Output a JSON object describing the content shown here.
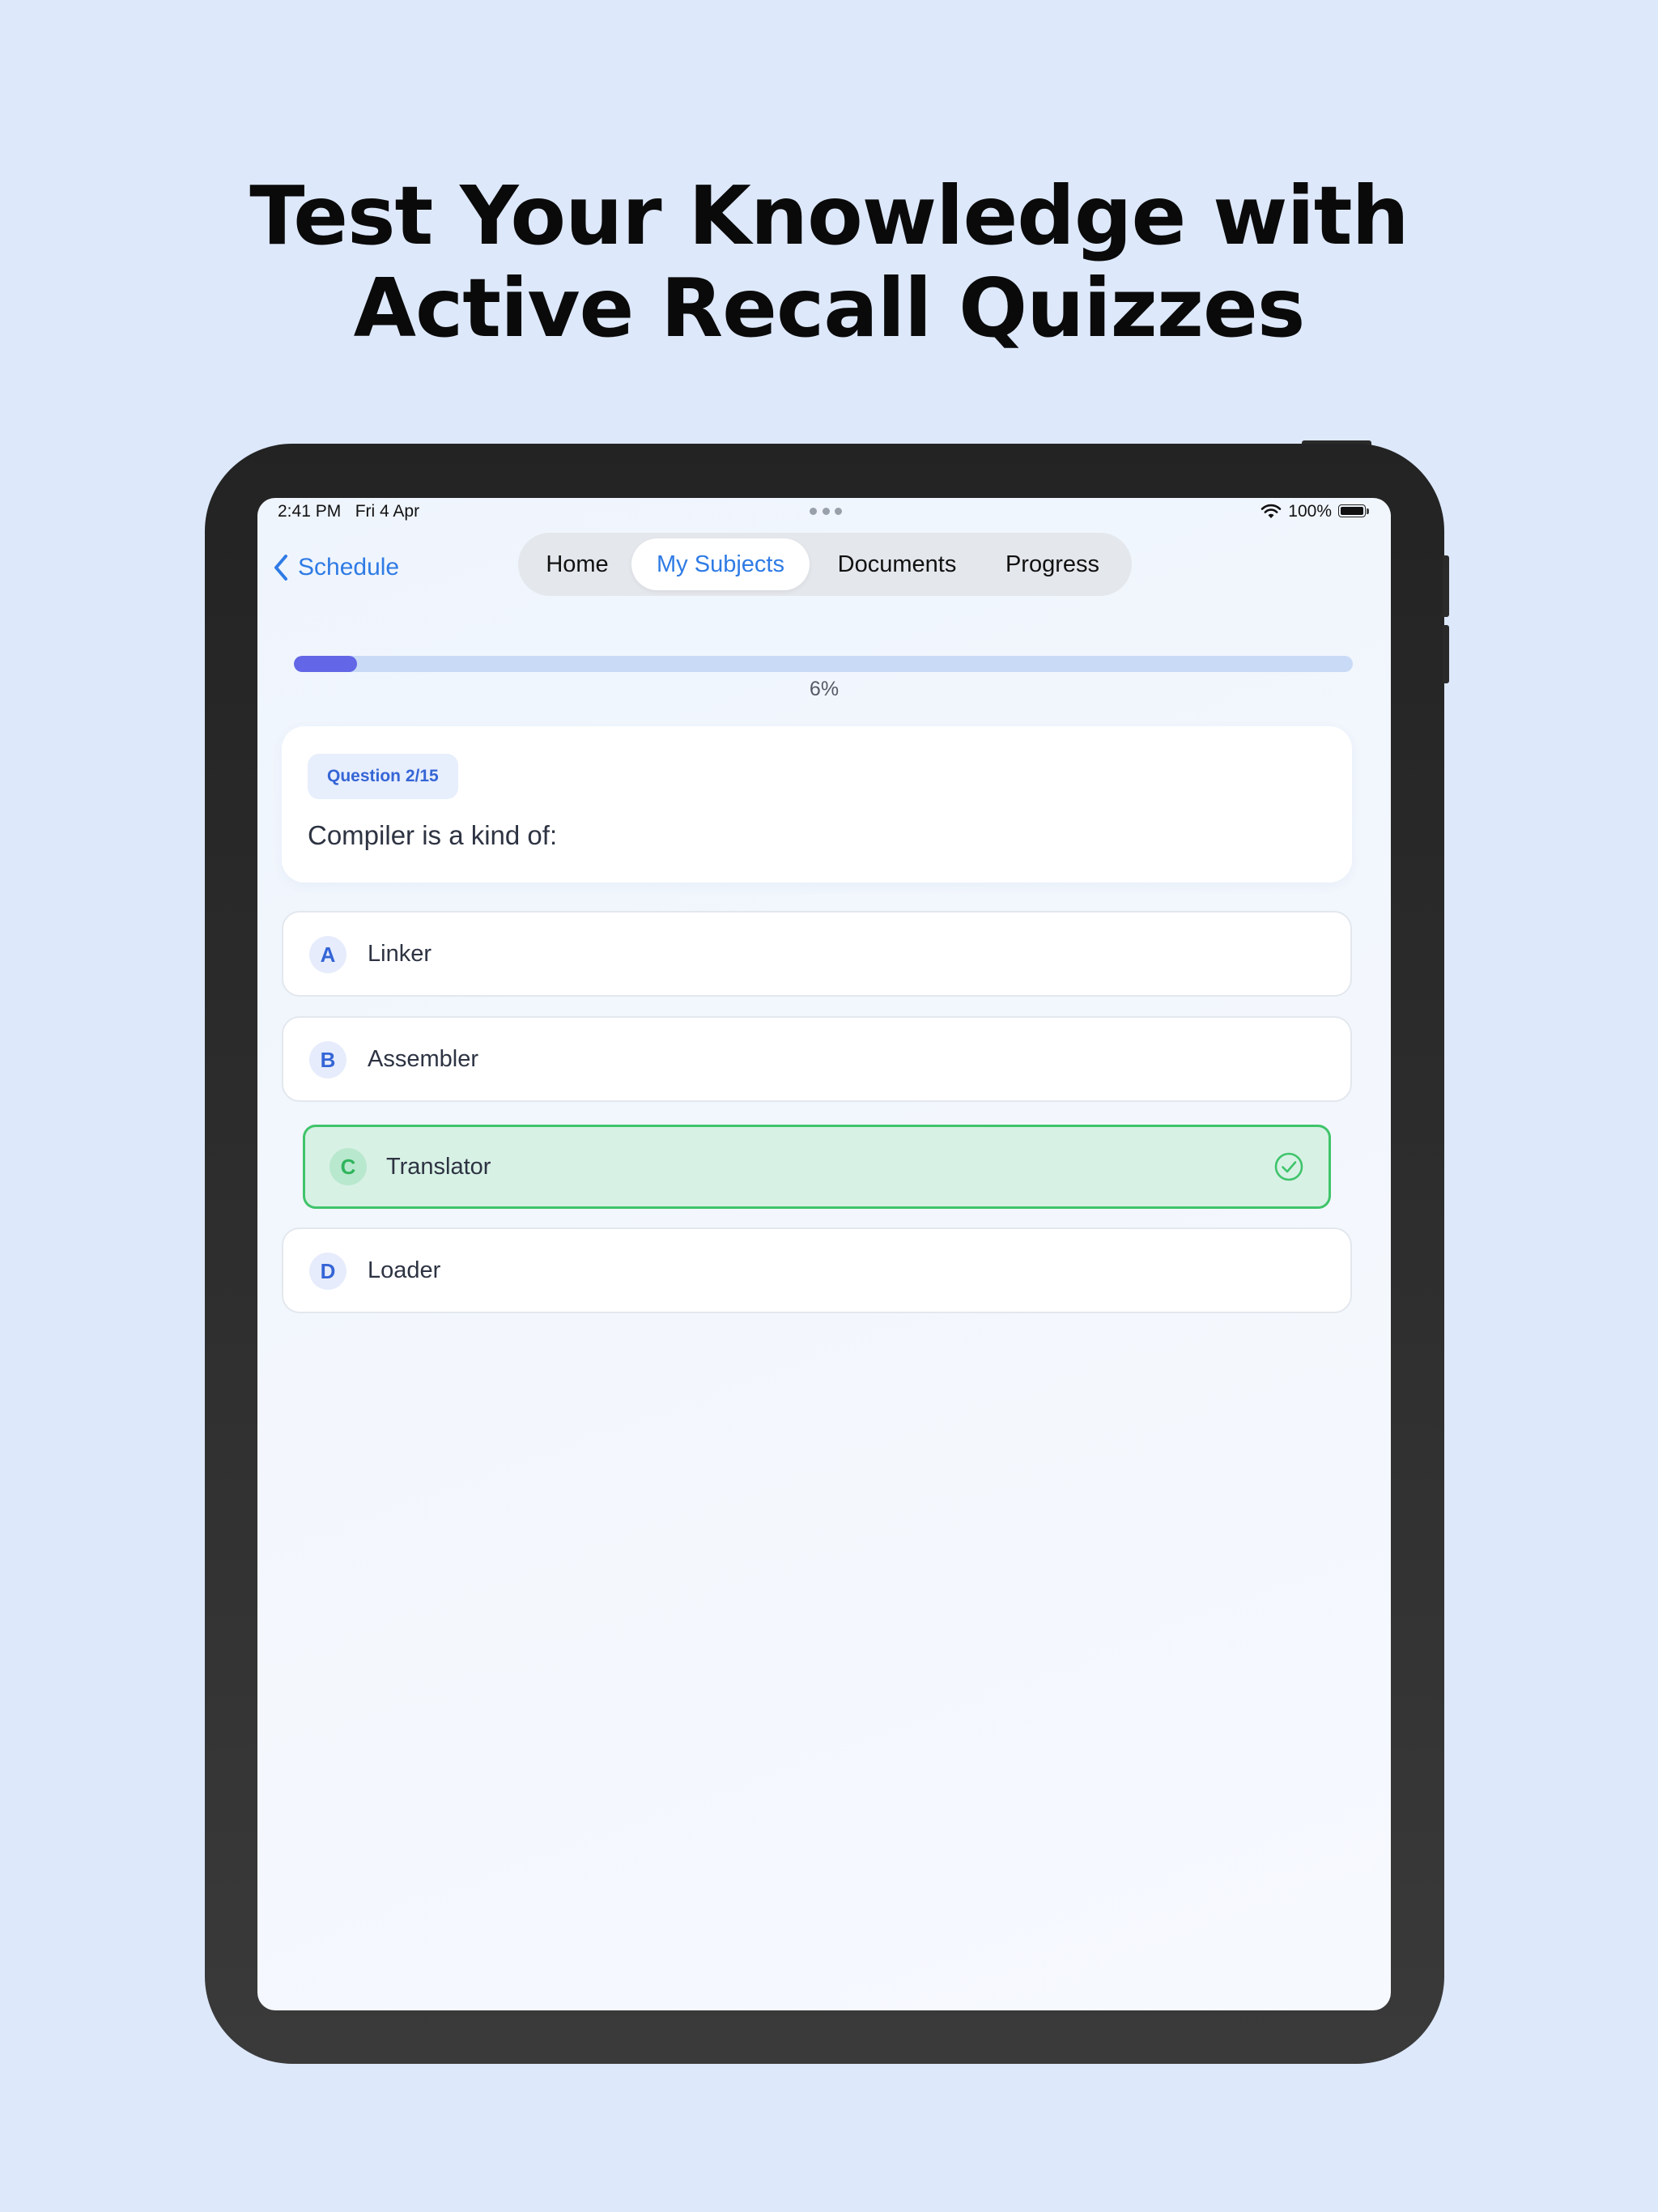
{
  "headline": {
    "line1": "Test Your Knowledge with",
    "line2": "Active Recall Quizzes"
  },
  "status_bar": {
    "time": "2:41 PM",
    "date": "Fri 4 Apr",
    "battery": "100%",
    "icons": [
      "wifi-icon",
      "battery-icon"
    ]
  },
  "nav": {
    "back_label": "Schedule",
    "back_icon": "chevron-left-icon",
    "tabs": [
      {
        "label": "Home",
        "active": false
      },
      {
        "label": "My Subjects",
        "active": true
      },
      {
        "label": "Documents",
        "active": false
      },
      {
        "label": "Progress",
        "active": false
      }
    ]
  },
  "progress": {
    "percent": 6,
    "label": "6%",
    "fill_color": "#6366e6",
    "track_color": "#c9daf6"
  },
  "question": {
    "badge": "Question 2/15",
    "text": "Compiler is a kind of:"
  },
  "options": [
    {
      "letter": "A",
      "label": "Linker",
      "selected": false
    },
    {
      "letter": "B",
      "label": "Assembler",
      "selected": false
    },
    {
      "letter": "C",
      "label": "Translator",
      "selected": true,
      "icon": "check-circle-icon"
    },
    {
      "letter": "D",
      "label": "Loader",
      "selected": false
    }
  ],
  "colors": {
    "background": "#dde8fb",
    "accent": "#2f7be5",
    "correct": "#3fc46a",
    "correct_bg": "#d8f1e5"
  }
}
